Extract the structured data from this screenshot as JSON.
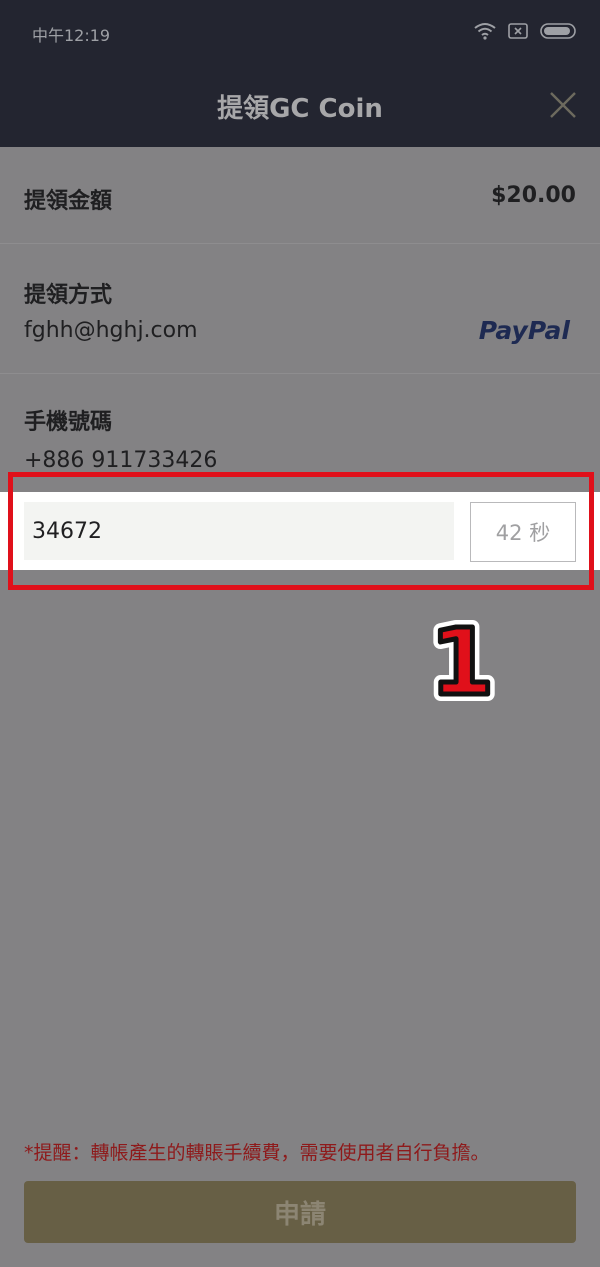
{
  "status_bar": {
    "time": "中午12:19"
  },
  "header": {
    "title": "提領GC Coin"
  },
  "amount_row": {
    "label": "提領金額",
    "value": "$20.00"
  },
  "method_row": {
    "label": "提領方式",
    "email": "fghh@hghj.com",
    "provider": "PayPal"
  },
  "phone_row": {
    "label": "手機號碼",
    "number": "+886 911733426"
  },
  "verification": {
    "code_value": "34672",
    "countdown": "42 秒"
  },
  "annotation": {
    "step_number": "1"
  },
  "notice": "*提醒：轉帳產生的轉賬手續費，需要使用者自行負擔。",
  "submit": {
    "label": "申請"
  },
  "colors": {
    "header_bg": "#232530",
    "overlay": "#838284",
    "highlight": "#e0101a",
    "button_bg": "#675f45",
    "notice_text": "#8e1a1b"
  }
}
